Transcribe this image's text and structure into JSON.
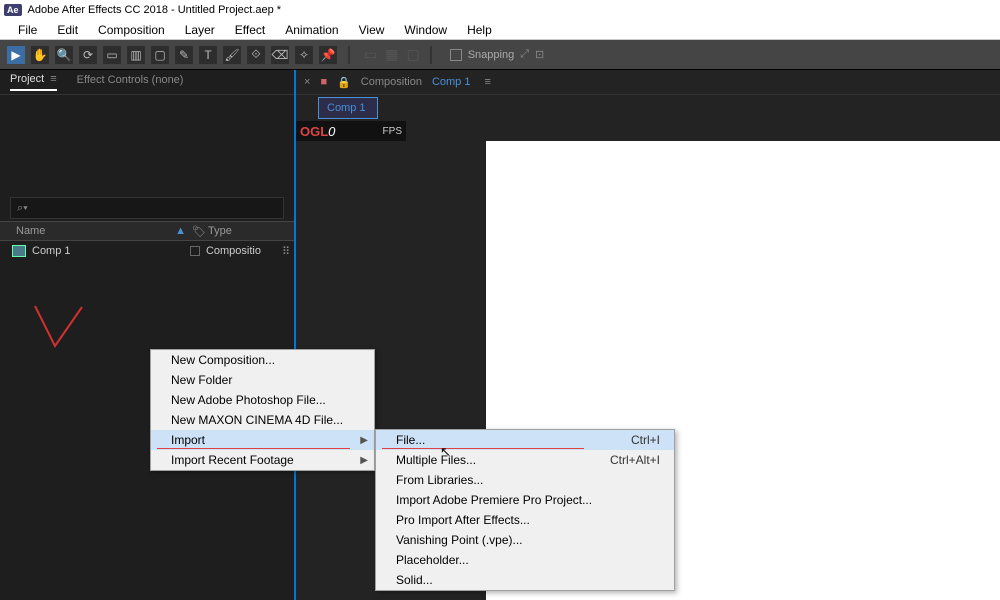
{
  "title": "Adobe After Effects CC 2018 - Untitled Project.aep *",
  "menubar": [
    "File",
    "Edit",
    "Composition",
    "Layer",
    "Effect",
    "Animation",
    "View",
    "Window",
    "Help"
  ],
  "toolbar": {
    "snapping": "Snapping"
  },
  "panels": {
    "project_tab": "Project",
    "effect_controls_tab": "Effect Controls (none)",
    "search_placeholder": "⌕▾",
    "cols": {
      "name": "Name",
      "type": "Type"
    },
    "item": {
      "name": "Comp 1",
      "type": "Compositio"
    }
  },
  "comp_panel": {
    "label": "Composition",
    "name": "Comp 1",
    "sub_tab": "Comp 1",
    "ogl": "OGL",
    "fps_value": "0",
    "fps_label": "FPS"
  },
  "context_menu_1": {
    "items": [
      {
        "label": "New Composition..."
      },
      {
        "label": "New Folder"
      },
      {
        "label": "New Adobe Photoshop File..."
      },
      {
        "label": "New MAXON CINEMA 4D File..."
      },
      {
        "label": "Import",
        "submenu": true,
        "redline": true,
        "highlight": true
      },
      {
        "label": "Import Recent Footage",
        "submenu": true
      }
    ]
  },
  "context_menu_2": {
    "items": [
      {
        "label": "File...",
        "shortcut": "Ctrl+I",
        "highlight": true,
        "redline": true
      },
      {
        "label": "Multiple Files...",
        "shortcut": "Ctrl+Alt+I"
      },
      {
        "label": "From Libraries..."
      },
      {
        "label": "Import Adobe Premiere Pro Project..."
      },
      {
        "label": "Pro Import After Effects..."
      },
      {
        "label": "Vanishing Point (.vpe)..."
      },
      {
        "label": "Placeholder..."
      },
      {
        "label": "Solid..."
      }
    ]
  }
}
